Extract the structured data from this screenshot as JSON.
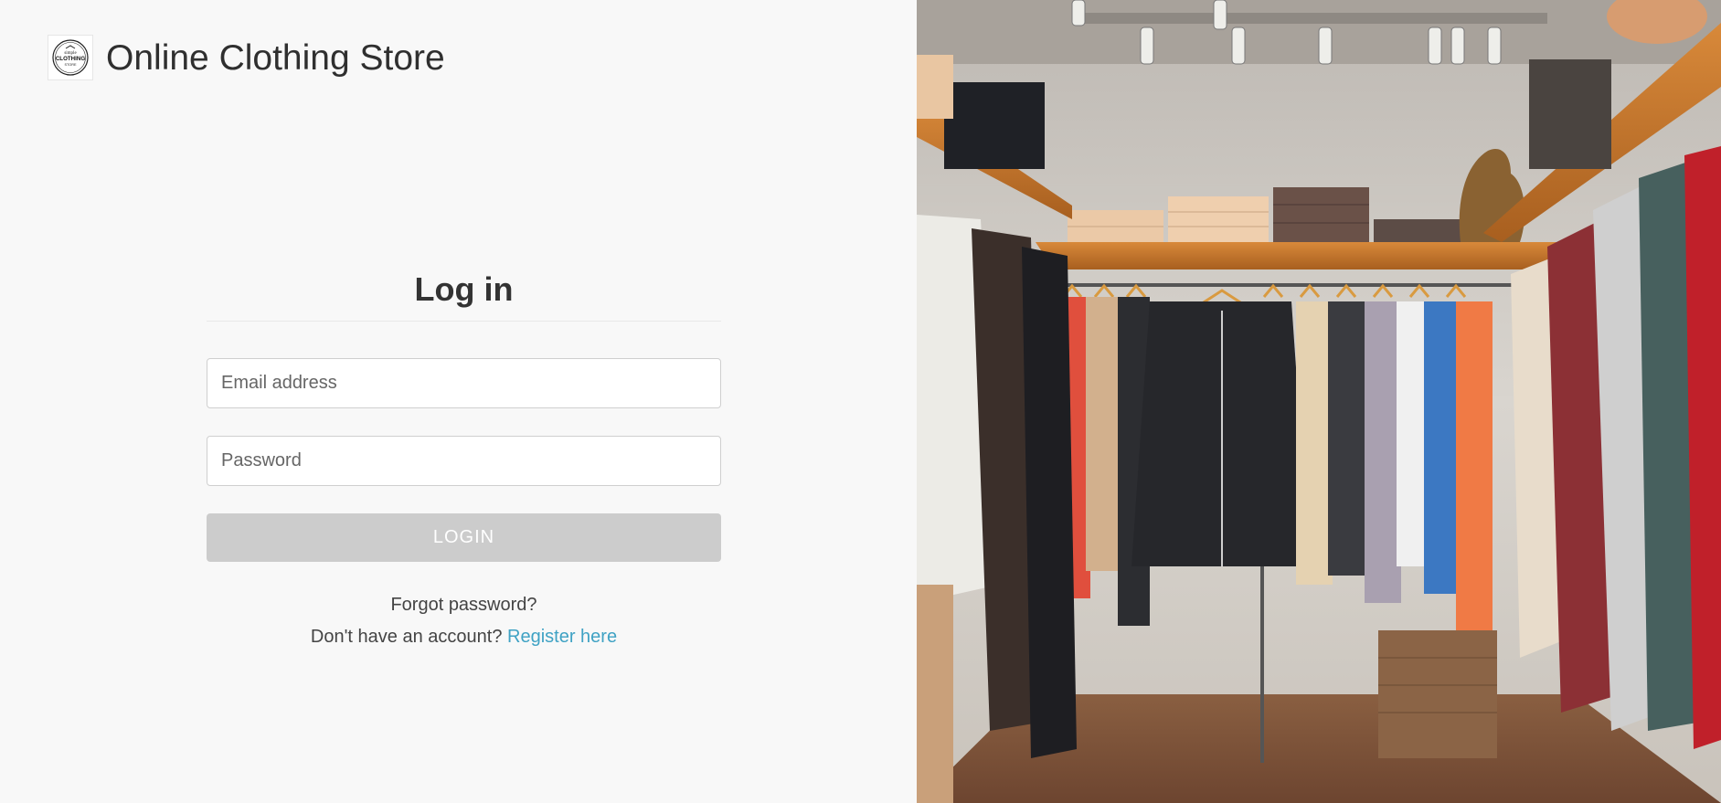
{
  "header": {
    "brand_title": "Online Clothing Store",
    "logo_icon": "store-logo-icon",
    "logo_text_top": "simple",
    "logo_text_main": "CLOTHING",
    "logo_text_bottom": "STORE"
  },
  "login": {
    "title": "Log in",
    "email_placeholder": "Email address",
    "email_value": "",
    "password_placeholder": "Password",
    "password_value": "",
    "login_button": "LOGIN",
    "forgot_password": "Forgot password?",
    "no_account_text": "Don't have an account?",
    "register_link": "Register here"
  },
  "hero": {
    "image_icon": "closet-clothing-photo"
  },
  "colors": {
    "background": "#f8f8f8",
    "button_disabled": "#cccccc",
    "link": "#3fa2c4",
    "text": "#333333"
  }
}
